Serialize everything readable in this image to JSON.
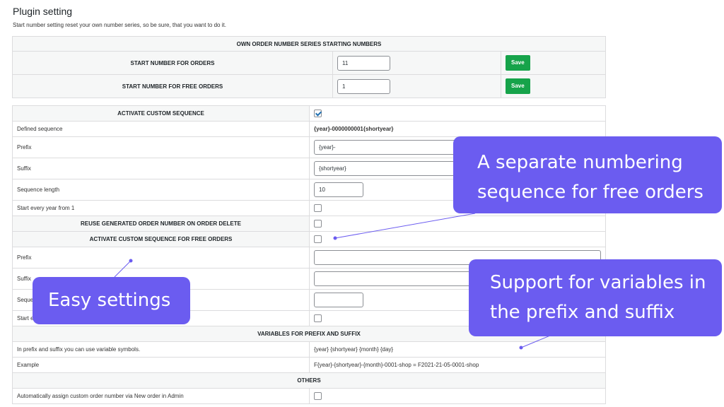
{
  "header": {
    "title": "Plugin setting",
    "description": "Start number setting reset your own number series, so be sure, that you want to do it."
  },
  "start_numbers": {
    "heading": "OWN ORDER NUMBER SERIES STARTING NUMBERS",
    "orders_label": "START NUMBER FOR ORDERS",
    "orders_value": "11",
    "free_label": "START NUMBER FOR FREE ORDERS",
    "free_value": "1",
    "save_label": "Save"
  },
  "sequence": {
    "activate_label": "ACTIVATE CUSTOM SEQUENCE",
    "activate_checked": true,
    "defined_label": "Defined sequence",
    "defined_value": "{year}-0000000001{shortyear}",
    "prefix_label": "Prefix",
    "prefix_value": "{year}-",
    "suffix_label": "Suffix",
    "suffix_value": "{shortyear}",
    "length_label": "Sequence length",
    "length_value": "10",
    "reset_label": "Start every year from 1",
    "reuse_label": "REUSE GENERATED ORDER NUMBER ON ORDER DELETE"
  },
  "free_sequence": {
    "activate_label": "ACTIVATE CUSTOM SEQUENCE FOR FREE ORDERS",
    "prefix_label": "Prefix",
    "suffix_label": "Suffix",
    "length_label": "Seque",
    "reset_label": "Start e"
  },
  "variables": {
    "heading": "VARIABLES FOR PREFIX AND SUFFIX",
    "info_label": "In prefix and suffix you can use variable symbols.",
    "info_value": "{year} {shortyear} {month} {day}",
    "example_label": "Example",
    "example_value": "F{year}-{shortyear}-{month}-0001-shop = F2021-21-05-0001-shop"
  },
  "others": {
    "heading": "OTHERS",
    "auto_label": "Automatically assign custom order number via New order in Admin"
  },
  "callouts": {
    "free_orders": "A separate numbering sequence for free orders",
    "easy": "Easy settings",
    "variables": "Support for variables in the prefix and suffix"
  },
  "colors": {
    "callout": "#6b5cf0",
    "save_button": "#16a34a",
    "header_bg": "#f6f7f7"
  }
}
